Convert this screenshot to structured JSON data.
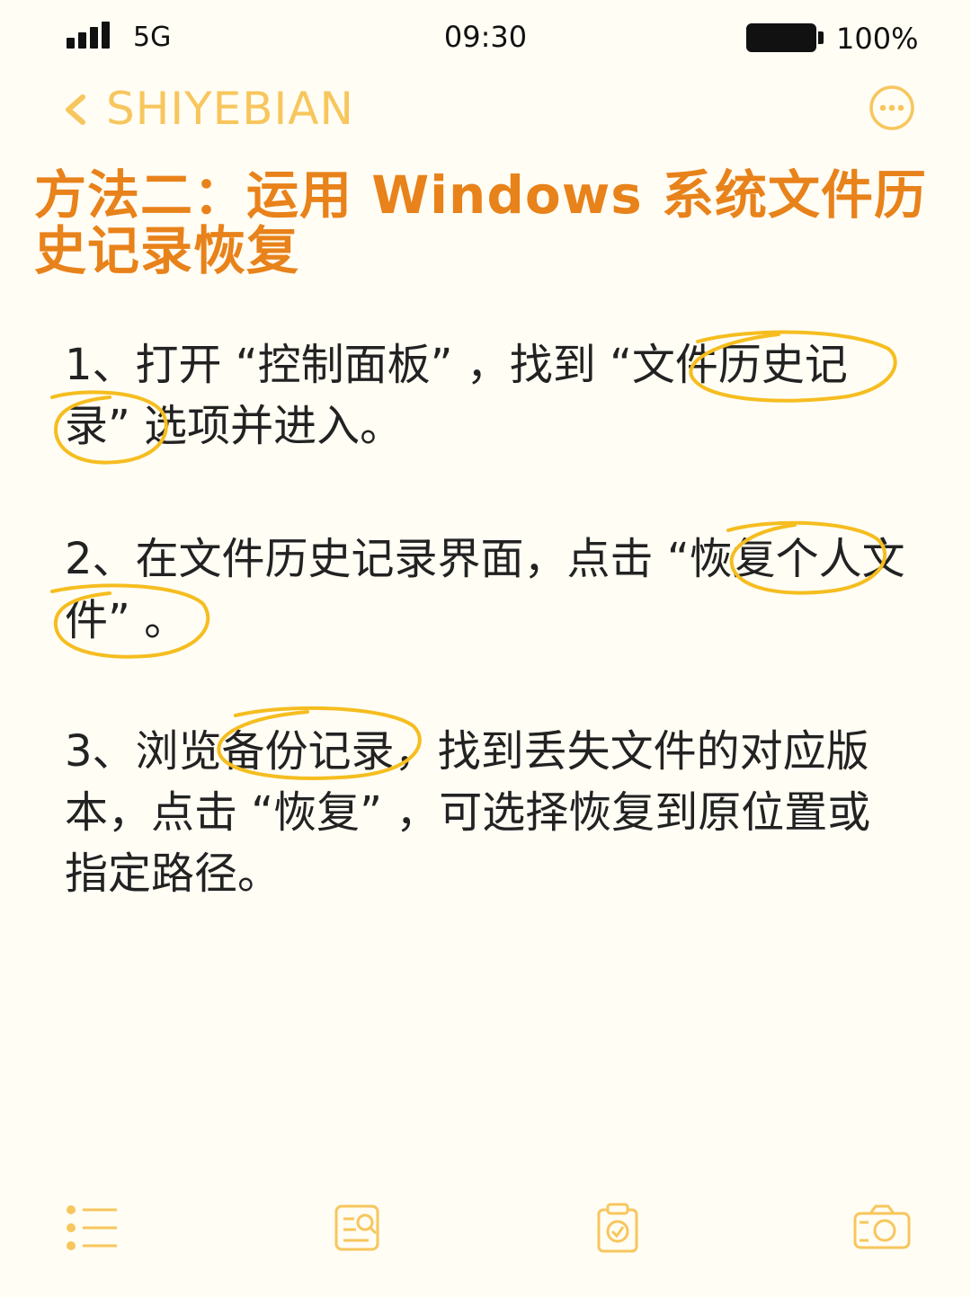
{
  "status_bar": {
    "network": "5G",
    "time": "09:30",
    "battery": "100%"
  },
  "nav": {
    "title": "SHIYEBIAN"
  },
  "heading": "方法二：运用 Windows 系统文件历史记录恢复",
  "steps": [
    {
      "before": "1、打开 “控制面板” ，找到 ",
      "highlight": "“文件历史记录”",
      "after": " 选项并进入。"
    },
    {
      "before": "2、在文件历史记录界面，点击 ",
      "highlight": "“恢复个人文件”",
      "after": " 。"
    },
    {
      "before": "3、浏览",
      "highlight": "备份记录",
      "after": "，找到丢失文件的对应版本，点击 “恢复” ，可选择恢复到原位置或指定路径。"
    }
  ],
  "colors": {
    "accent_title": "#e8821a",
    "nav_accent": "#f7c65d",
    "highlight_ring": "#f5bd1f",
    "background": "#fffdf4"
  },
  "bottom_icons": [
    "list-icon",
    "search-doc-icon",
    "clipboard-check-icon",
    "camera-icon"
  ]
}
